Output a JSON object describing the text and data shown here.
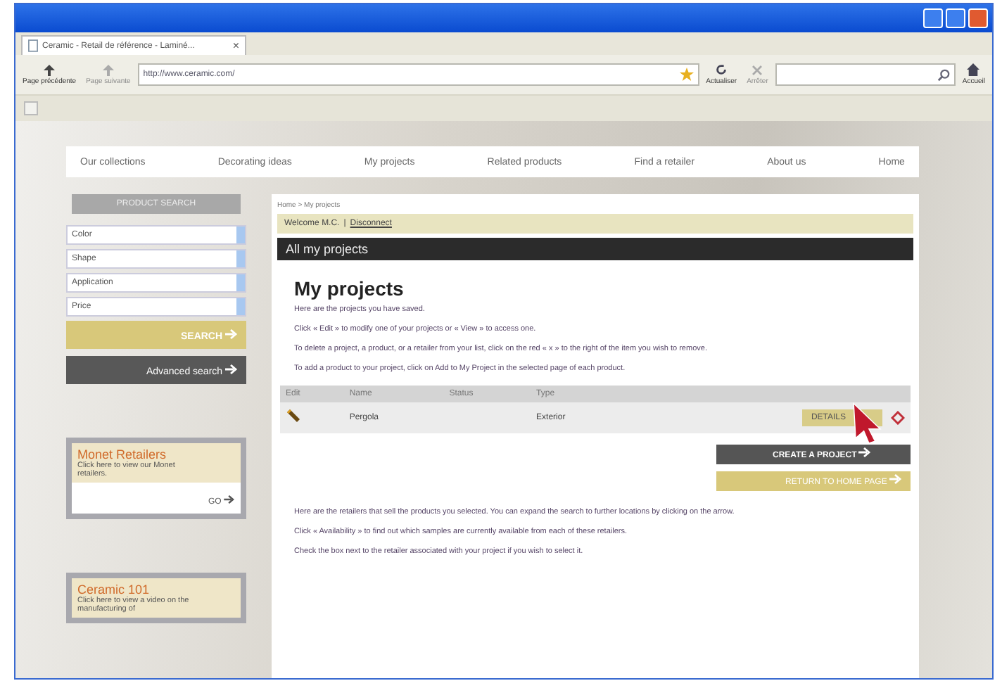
{
  "browser": {
    "tab_title": "Ceramic - Retail de référence - Laminé...",
    "tab_close": "×",
    "back": "Page précédente",
    "forward": "Page suivante",
    "address": "http://www.ceramic.com/",
    "refresh": "Actualiser",
    "stop": "Arrêter",
    "home": "Accueil"
  },
  "nav": [
    "Our collections",
    "Decorating ideas",
    "My projects",
    "Related products",
    "Find a retailer",
    "About us",
    "Home"
  ],
  "sidebar": {
    "title": "PRODUCT SEARCH",
    "filters": [
      "Color",
      "Shape",
      "Application",
      "Price"
    ],
    "search_button": "SEARCH",
    "advanced_button": "Advanced search",
    "cards": [
      {
        "title": "Monet Retailers",
        "text": "Click here to view our Monet retailers.",
        "link": "GO"
      },
      {
        "title": "Ceramic 101",
        "text": "Click here to view a video on the manufacturing of"
      }
    ]
  },
  "main": {
    "breadcrumb": "Home > My projects",
    "welcome": "Welcome M.C.",
    "separator": "|",
    "disconnect": "Disconnect",
    "banner": "All my projects",
    "heading": "My projects",
    "intro": [
      "Here are the projects you have saved.",
      "Click « Edit » to modify one of your projects or « View » to access one.",
      "To delete a project, a product, or a retailer from your list, click on the red « x » to the right of the item you wish to remove.",
      "To add a product to your project, click on Add to My Project in the selected page of each product."
    ],
    "table": {
      "columns": [
        "Edit",
        "Name",
        "Status",
        "Type"
      ],
      "rows": [
        {
          "name": "Pergola",
          "type": "Exterior",
          "button": "DETAILS"
        }
      ]
    },
    "create_button": "CREATE A PROJECT",
    "return_button": "RETURN TO HOME PAGE",
    "outro": [
      "Here are the retailers that sell the products you selected. You can expand the search to further locations by clicking on the arrow.",
      "Click « Availability » to find out which samples are currently available from each of these retailers.",
      "Check the box next to the retailer associated with your project if you wish to select it."
    ]
  }
}
